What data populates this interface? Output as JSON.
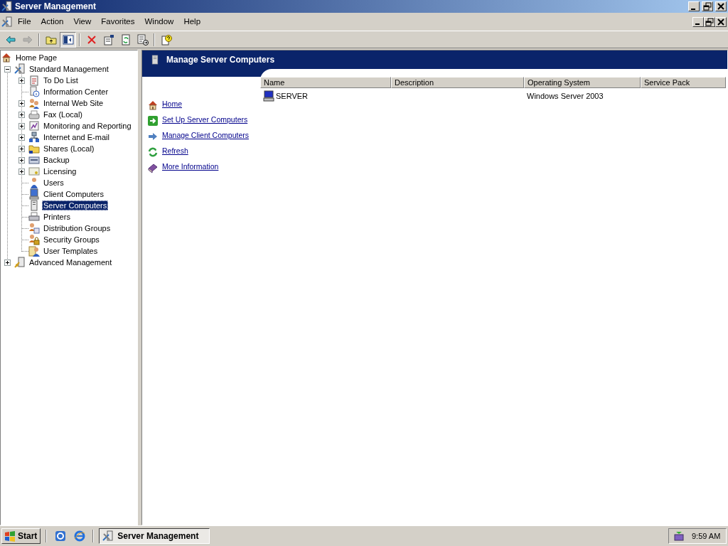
{
  "window": {
    "title": "Server Management"
  },
  "menu_bar": {
    "items": [
      {
        "label": "File"
      },
      {
        "label": "Action"
      },
      {
        "label": "View"
      },
      {
        "label": "Favorites"
      },
      {
        "label": "Window"
      },
      {
        "label": "Help"
      }
    ]
  },
  "toolbar": {
    "buttons": [
      {
        "disabled": false,
        "pressed": false
      },
      {
        "disabled": true,
        "pressed": false
      },
      {
        "disabled": false,
        "pressed": false
      },
      {
        "disabled": false,
        "pressed": true
      },
      {
        "disabled": false,
        "pressed": false
      },
      {
        "disabled": false,
        "pressed": false
      },
      {
        "disabled": false,
        "pressed": false
      },
      {
        "disabled": false,
        "pressed": false
      },
      {
        "disabled": false,
        "pressed": false
      }
    ]
  },
  "tree": {
    "items": [
      {
        "label": "Home Page",
        "selected": false
      },
      {
        "label": "Standard Management",
        "selected": false,
        "expanded": true,
        "children": [
          {
            "label": "To Do List",
            "selected": false,
            "expanded": false
          },
          {
            "label": "Information Center",
            "selected": false
          },
          {
            "label": "Internal Web Site",
            "selected": false,
            "expanded": false
          },
          {
            "label": "Fax (Local)",
            "selected": false,
            "expanded": false
          },
          {
            "label": "Monitoring and Reporting",
            "selected": false,
            "expanded": false
          },
          {
            "label": "Internet and E-mail",
            "selected": false,
            "expanded": false
          },
          {
            "label": "Shares (Local)",
            "selected": false,
            "expanded": false
          },
          {
            "label": "Backup",
            "selected": false,
            "expanded": false
          },
          {
            "label": "Licensing",
            "selected": false,
            "expanded": false
          },
          {
            "label": "Users",
            "selected": false
          },
          {
            "label": "Client Computers",
            "selected": false
          },
          {
            "label": "Server Computers",
            "selected": true
          },
          {
            "label": "Printers",
            "selected": false
          },
          {
            "label": "Distribution Groups",
            "selected": false
          },
          {
            "label": "Security Groups",
            "selected": false
          },
          {
            "label": "User Templates",
            "selected": false
          }
        ]
      },
      {
        "label": "Advanced Management",
        "selected": false,
        "expanded": false
      }
    ]
  },
  "details": {
    "title": "Manage Server Computers",
    "links": [
      {
        "label": "Home"
      },
      {
        "label": "Set Up Server Computers"
      },
      {
        "label": "Manage Client Computers"
      },
      {
        "label": "Refresh"
      },
      {
        "label": "More Information"
      }
    ],
    "table": {
      "columns": [
        "Name",
        "Description",
        "Operating System",
        "Service Pack"
      ],
      "rows": [
        {
          "name": "SERVER",
          "operating_system": "Windows Server 2003"
        }
      ]
    }
  },
  "taskbar": {
    "start_label": "Start",
    "tasks": [
      {
        "label": "Server Management",
        "selected": true
      }
    ],
    "clock": "9:59 AM"
  }
}
